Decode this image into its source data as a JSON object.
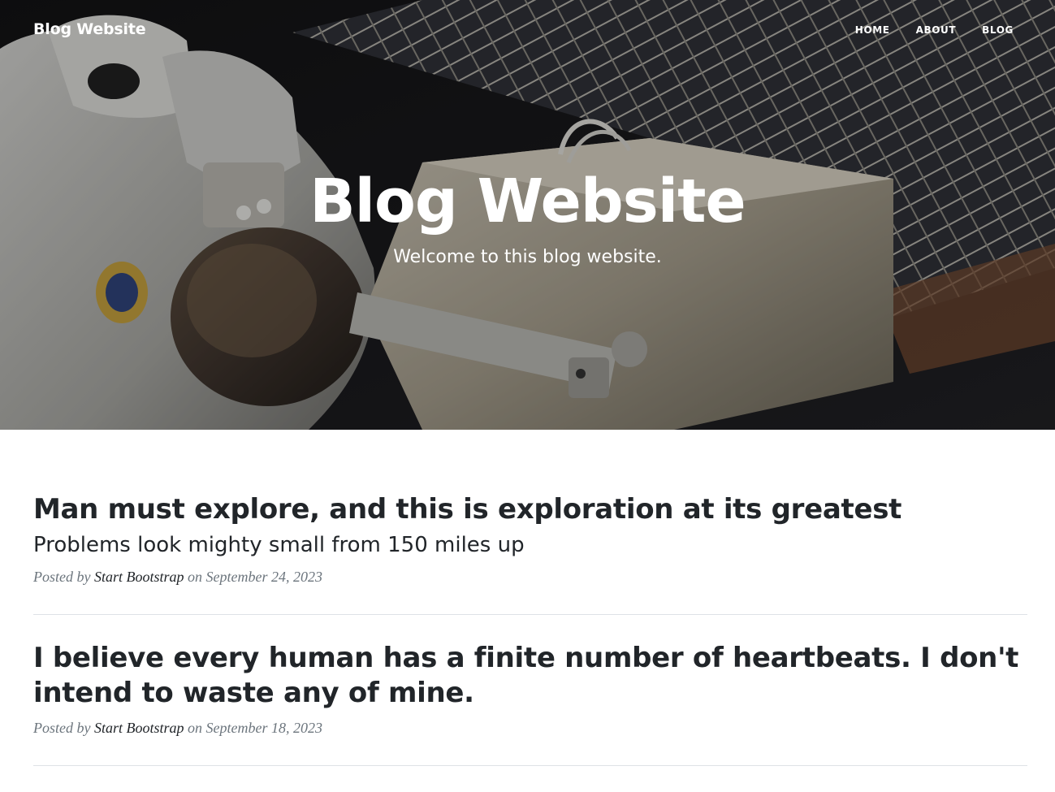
{
  "navbar": {
    "brand": "Blog Website",
    "links": [
      {
        "label": "HOME"
      },
      {
        "label": "ABOUT"
      },
      {
        "label": "BLOG"
      }
    ]
  },
  "hero": {
    "title": "Blog Website",
    "subtitle": "Welcome to this blog website."
  },
  "posts": [
    {
      "title": "Man must explore, and this is exploration at its greatest",
      "subtitle": "Problems look mighty small from 150 miles up",
      "posted_by_prefix": "Posted by",
      "author": "Start Bootstrap",
      "on_prefix": "on",
      "date": "September 24, 2023"
    },
    {
      "title": "I believe every human has a finite number of heartbeats. I don't intend to waste any of mine.",
      "posted_by_prefix": "Posted by",
      "author": "Start Bootstrap",
      "on_prefix": "on",
      "date": "September 18, 2023"
    }
  ]
}
